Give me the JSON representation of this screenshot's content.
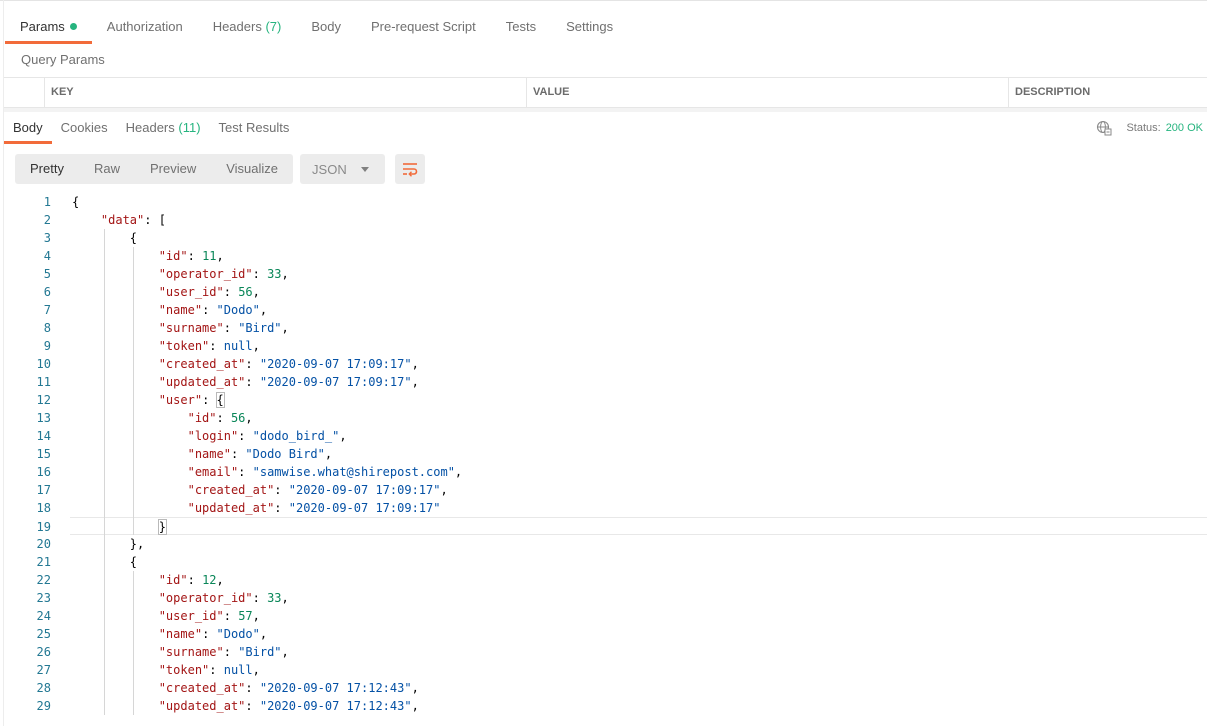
{
  "request_tabs": [
    {
      "label": "Params",
      "badge_dot": true
    },
    {
      "label": "Authorization"
    },
    {
      "label": "Headers",
      "count": "(7)"
    },
    {
      "label": "Body"
    },
    {
      "label": "Pre-request Script"
    },
    {
      "label": "Tests"
    },
    {
      "label": "Settings"
    }
  ],
  "query_params": {
    "title": "Query Params",
    "columns": [
      "KEY",
      "VALUE",
      "DESCRIPTION"
    ]
  },
  "response_tabs": [
    {
      "label": "Body"
    },
    {
      "label": "Cookies"
    },
    {
      "label": "Headers",
      "count": "(11)"
    },
    {
      "label": "Test Results"
    }
  ],
  "status": {
    "label": "Status:",
    "value": "200 OK"
  },
  "view_modes": [
    "Pretty",
    "Raw",
    "Preview",
    "Visualize"
  ],
  "format_select": {
    "value": "JSON"
  },
  "icons": {
    "status": "globe-icon",
    "wrap": "text-wrap-icon",
    "format_dropdown": "chevron-down-icon"
  },
  "colors": {
    "accent": "#f26b3a",
    "success": "#26b47f",
    "json_key": "#a31515",
    "json_string": "#0451a5",
    "json_number": "#098658"
  },
  "code_lines": [
    [
      [
        "p",
        "{"
      ]
    ],
    [
      [
        "k",
        "\"data\""
      ],
      [
        "p",
        ": ["
      ]
    ],
    [
      [
        "p",
        "{"
      ]
    ],
    [
      [
        "k",
        "\"id\""
      ],
      [
        "p",
        ": "
      ],
      [
        "n",
        "11"
      ],
      [
        "p",
        ","
      ]
    ],
    [
      [
        "k",
        "\"operator_id\""
      ],
      [
        "p",
        ": "
      ],
      [
        "n",
        "33"
      ],
      [
        "p",
        ","
      ]
    ],
    [
      [
        "k",
        "\"user_id\""
      ],
      [
        "p",
        ": "
      ],
      [
        "n",
        "56"
      ],
      [
        "p",
        ","
      ]
    ],
    [
      [
        "k",
        "\"name\""
      ],
      [
        "p",
        ": "
      ],
      [
        "s",
        "\"Dodo\""
      ],
      [
        "p",
        ","
      ]
    ],
    [
      [
        "k",
        "\"surname\""
      ],
      [
        "p",
        ": "
      ],
      [
        "s",
        "\"Bird\""
      ],
      [
        "p",
        ","
      ]
    ],
    [
      [
        "k",
        "\"token\""
      ],
      [
        "p",
        ": "
      ],
      [
        "kw",
        "null"
      ],
      [
        "p",
        ","
      ]
    ],
    [
      [
        "k",
        "\"created_at\""
      ],
      [
        "p",
        ": "
      ],
      [
        "s",
        "\"2020-09-07 17:09:17\""
      ],
      [
        "p",
        ","
      ]
    ],
    [
      [
        "k",
        "\"updated_at\""
      ],
      [
        "p",
        ": "
      ],
      [
        "s",
        "\"2020-09-07 17:09:17\""
      ],
      [
        "p",
        ","
      ]
    ],
    [
      [
        "k",
        "\"user\""
      ],
      [
        "p",
        ": "
      ],
      [
        "bm",
        "{"
      ]
    ],
    [
      [
        "k",
        "\"id\""
      ],
      [
        "p",
        ": "
      ],
      [
        "n",
        "56"
      ],
      [
        "p",
        ","
      ]
    ],
    [
      [
        "k",
        "\"login\""
      ],
      [
        "p",
        ": "
      ],
      [
        "s",
        "\"dodo_bird_\""
      ],
      [
        "p",
        ","
      ]
    ],
    [
      [
        "k",
        "\"name\""
      ],
      [
        "p",
        ": "
      ],
      [
        "s",
        "\"Dodo Bird\""
      ],
      [
        "p",
        ","
      ]
    ],
    [
      [
        "k",
        "\"email\""
      ],
      [
        "p",
        ": "
      ],
      [
        "s",
        "\"samwise.what@shirepost.com\""
      ],
      [
        "p",
        ","
      ]
    ],
    [
      [
        "k",
        "\"created_at\""
      ],
      [
        "p",
        ": "
      ],
      [
        "s",
        "\"2020-09-07 17:09:17\""
      ],
      [
        "p",
        ","
      ]
    ],
    [
      [
        "k",
        "\"updated_at\""
      ],
      [
        "p",
        ": "
      ],
      [
        "s",
        "\"2020-09-07 17:09:17\""
      ]
    ],
    [
      [
        "bm",
        "}"
      ],
      [
        "cur",
        ""
      ]
    ],
    [
      [
        "p",
        "},"
      ]
    ],
    [
      [
        "p",
        "{"
      ]
    ],
    [
      [
        "k",
        "\"id\""
      ],
      [
        "p",
        ": "
      ],
      [
        "n",
        "12"
      ],
      [
        "p",
        ","
      ]
    ],
    [
      [
        "k",
        "\"operator_id\""
      ],
      [
        "p",
        ": "
      ],
      [
        "n",
        "33"
      ],
      [
        "p",
        ","
      ]
    ],
    [
      [
        "k",
        "\"user_id\""
      ],
      [
        "p",
        ": "
      ],
      [
        "n",
        "57"
      ],
      [
        "p",
        ","
      ]
    ],
    [
      [
        "k",
        "\"name\""
      ],
      [
        "p",
        ": "
      ],
      [
        "s",
        "\"Dodo\""
      ],
      [
        "p",
        ","
      ]
    ],
    [
      [
        "k",
        "\"surname\""
      ],
      [
        "p",
        ": "
      ],
      [
        "s",
        "\"Bird\""
      ],
      [
        "p",
        ","
      ]
    ],
    [
      [
        "k",
        "\"token\""
      ],
      [
        "p",
        ": "
      ],
      [
        "kw",
        "null"
      ],
      [
        "p",
        ","
      ]
    ],
    [
      [
        "k",
        "\"created_at\""
      ],
      [
        "p",
        ": "
      ],
      [
        "s",
        "\"2020-09-07 17:12:43\""
      ],
      [
        "p",
        ","
      ]
    ],
    [
      [
        "k",
        "\"updated_at\""
      ],
      [
        "p",
        ": "
      ],
      [
        "s",
        "\"2020-09-07 17:12:43\""
      ],
      [
        "p",
        ","
      ]
    ]
  ]
}
